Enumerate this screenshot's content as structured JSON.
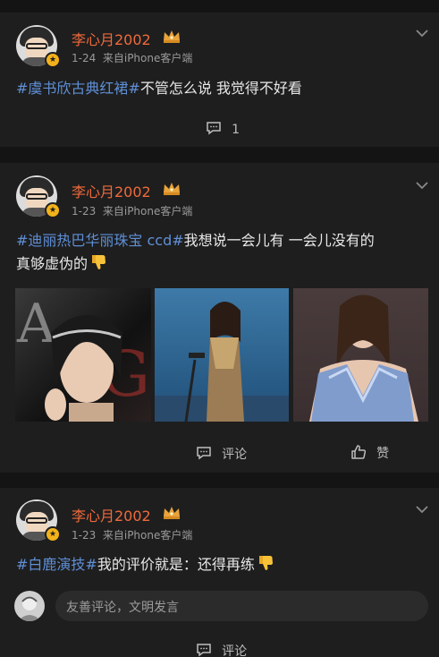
{
  "posts": [
    {
      "username": "李心月2002",
      "meta": "1-24  来自iPhone客户端",
      "hashtag": "#虞书欣古典红裙#",
      "text": "不管怎么说 我觉得不好看",
      "comment_count": "1"
    },
    {
      "username": "李心月2002",
      "meta": "1-23  来自iPhone客户端",
      "hashtag": "#迪丽热巴华丽珠宝 ccd#",
      "text_line1": "我想说一会儿有 一会儿没有的",
      "text_line2": "真够虚伪的",
      "comment_label": "评论",
      "like_label": "赞"
    },
    {
      "username": "李心月2002",
      "meta": "1-23  来自iPhone客户端",
      "hashtag": "#白鹿演技#",
      "text": "我的评价就是：还得再练",
      "comment_placeholder": "友善评论，文明发言",
      "comment_label": "评论"
    }
  ],
  "colors": {
    "username": "#f06a3c",
    "hashtag": "#5f8fd6",
    "vip_badge": "#f3b21b"
  }
}
